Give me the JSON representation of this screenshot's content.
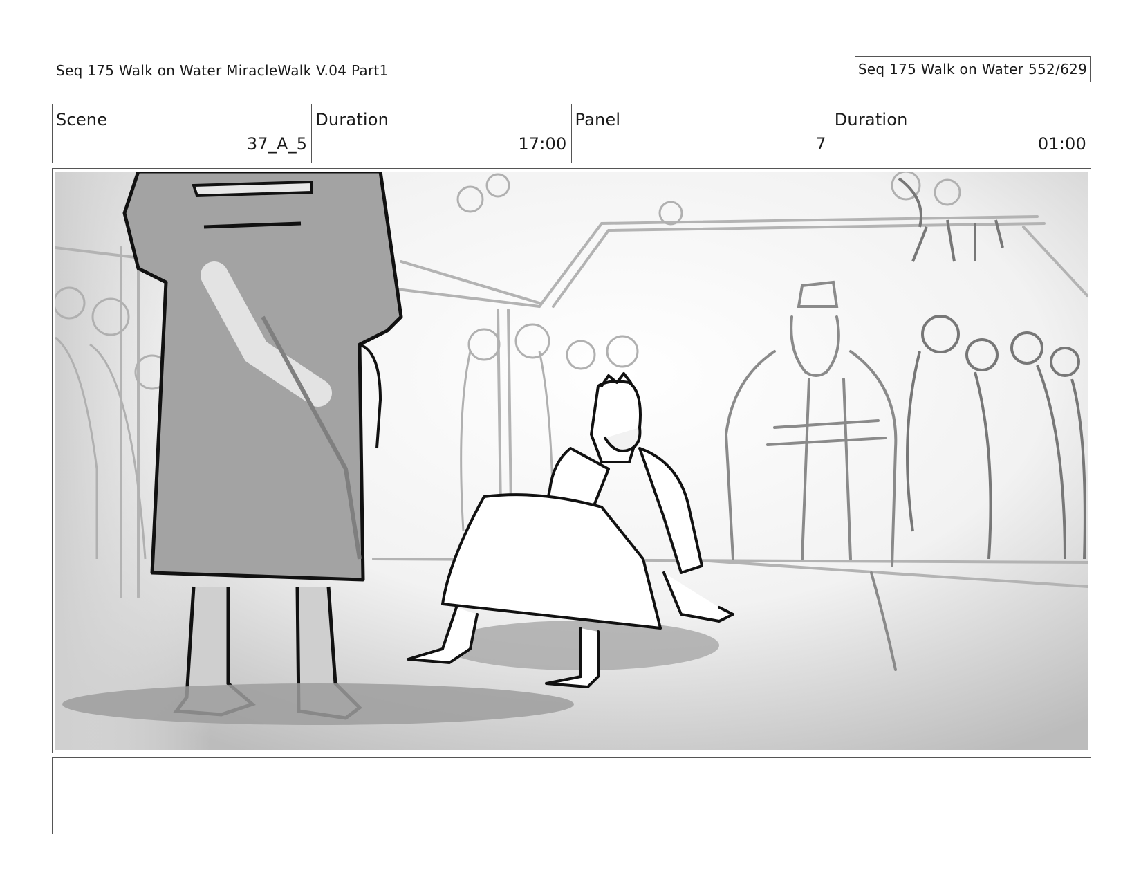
{
  "header": {
    "title": "Seq 175 Walk on Water  MiracleWalk V.04 Part1",
    "page_counter": "Seq 175 Walk on Water 552/629"
  },
  "info": {
    "scene_label": "Scene",
    "scene_value": "37_A_5",
    "scene_duration_label": "Duration",
    "scene_duration_value": "17:00",
    "panel_label": "Panel",
    "panel_value": "7",
    "panel_duration_label": "Duration",
    "panel_duration_value": "01:00"
  },
  "panel": {
    "image_icon": "storyboard-sketch"
  },
  "notes": {
    "text": ""
  }
}
